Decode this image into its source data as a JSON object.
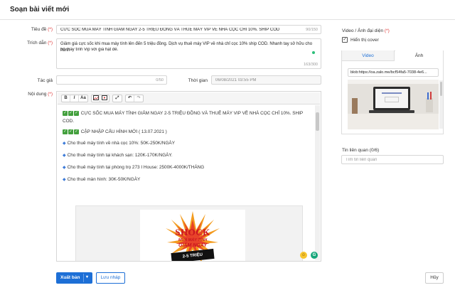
{
  "header": {
    "title": "Soạn bài viết mới"
  },
  "form": {
    "title_label": "Tiêu đề",
    "title_value": "CƯC SỐC MUA MÁY TÍNH GIẢM NGAY 2-5 TRIỆU ĐỒNG VÀ THUÊ MÁY VIP VỀ NHÀ CỌC CHỈ 10%. SHIP COD",
    "title_counter": "90/150",
    "summary_label": "Trích dẫn",
    "summary_line1": "Giảm giá cực sốc khi mua máy tính lên đến 5 triệu đồng. Dịch vụ thuê máy VIP về nhà chỉ cọc 10% ship COD. Nhanh tay sở hữu cho mình",
    "summary_line2": "bộ máy tính Vip với giá hạt dẻ.",
    "summary_counter": "163/300",
    "author_label": "Tác giả",
    "author_counter": "0/50",
    "time_label": "Thời gian",
    "time_value": "06/08/2021 03:55 PM",
    "content_label": "Nội dung",
    "required_mark": "(*)"
  },
  "toolbar": {
    "bold": "B",
    "italic": "I",
    "fontsize": "Aa",
    "undo": "↶",
    "redo": "↷",
    "fullscreen": "⤢"
  },
  "content": {
    "headline": "CỰC SỐC MUA MÁY TÍNH GIẢM NGAY 2-5 TRIỆU ĐỒNG VÀ THUÊ MÁY VIP VỀ NHÀ CỌC CHỈ 10%. SHIP",
    "headline_cont": "COD.",
    "update_line": "CẬP NHẬP CẤU HÌNH MỚI ( 13.07.2021 )",
    "items": [
      "Cho thuê máy tính về nhà cọc 10%: 50K-250K/NGÀY",
      "Cho thuê máy tính tại khách sạn: 120K-170K/NGÀY.",
      "Cho thuê máy tính tại phòng trọ 273 I House: 2500K-4000K/THÁNG",
      "Cho thuê màn hình: 30K-50K/NGÀY"
    ],
    "promo_big": "SHOCK",
    "promo_line1": "MUA MÁY TÍNH",
    "promo_line2": "GIẢM NGAY",
    "promo_line3": "2-5 TRIỆU"
  },
  "actions": {
    "publish": "Xuất bản",
    "draft": "Lưu nháp",
    "cancel": "Hủy"
  },
  "sidebar": {
    "media_label": "Video / Ảnh đại diện",
    "show_cover": "Hiển thị cover",
    "tab_video": "Video",
    "tab_image": "Ảnh",
    "image_url": "blob:https://oa.zalo.me/bcf54fa5-7038-4e6...",
    "related_label": "Tin liên quan (0/6)",
    "related_placeholder": "Tìm tin liên quan"
  },
  "colors": {
    "accent": "#1d6fd6",
    "required": "#d33333",
    "check": "#43a03d"
  }
}
